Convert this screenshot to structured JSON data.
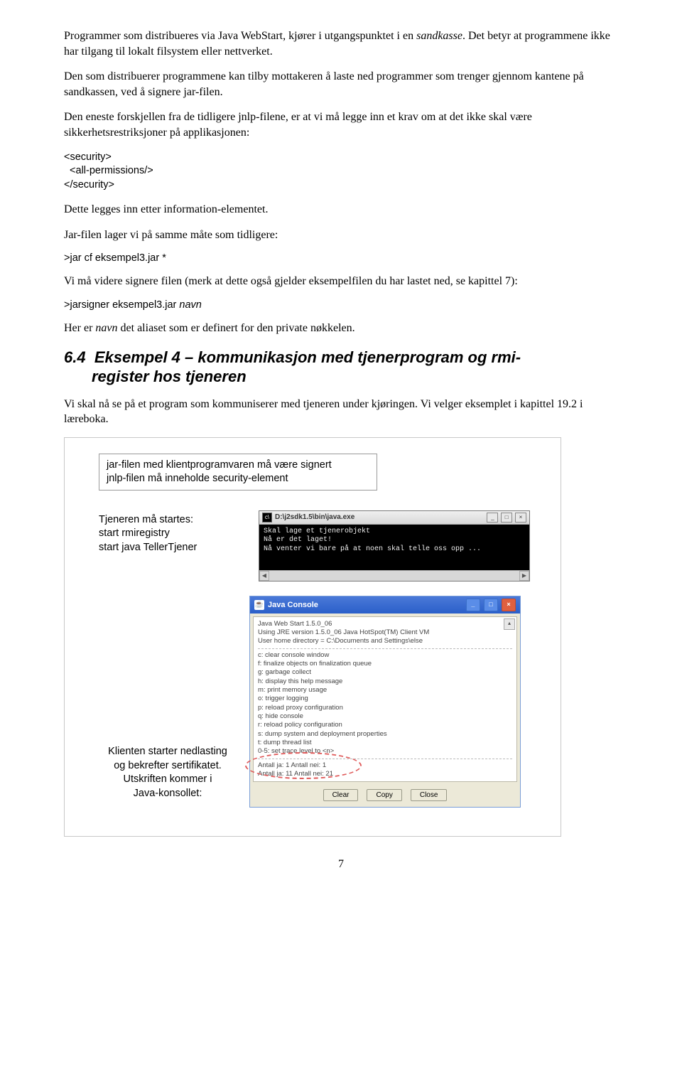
{
  "para1a": "Programmer som distribueres via Java WebStart, kjører i utgangspunktet i en ",
  "para1_i": "sandkasse",
  "para1b": ". Det betyr at programmene ikke har tilgang til lokalt filsystem eller nettverket.",
  "para2": "Den som distribuerer programmene kan tilby mottakeren å laste ned programmer som trenger gjennom kantene på sandkassen, ved å signere jar-filen.",
  "para3": "Den eneste forskjellen fra de tidligere jnlp-filene, er at vi må legge inn et krav om at det ikke skal være sikkerhetsrestriksjoner på applikasjonen:",
  "code1": "<security>\n  <all-permissions/>\n</security>",
  "para4": "Dette legges inn etter information-elementet.",
  "para5": "Jar-filen lager vi på samme måte som tidligere:",
  "cmd1": ">jar cf eksempel3.jar *",
  "para6": "Vi må videre signere filen (merk at dette også gjelder eksempelfilen du har lastet ned, se kapittel 7):",
  "cmd2a": ">jarsigner eksempel3.jar ",
  "cmd2_i": "navn",
  "para7a": "Her er ",
  "para7_i": "navn",
  "para7b": " det aliaset som er definert for den private nøkkelen.",
  "h2_num": "6.4",
  "h2_l1": "Eksempel 4 – kommunikasjon med tjenerprogram og rmi-",
  "h2_l2": "register hos tjeneren",
  "para8": "Vi skal nå se på et program som kommuniserer med tjeneren under kjøringen. Vi velger eksemplet i kapittel 19.2 i læreboka.",
  "box_top_l1": "jar-filen med klientprogramvaren må være signert",
  "box_top_l2": "jnlp-filen må inneholde security-element",
  "left1_l1": "Tjeneren må startes:",
  "left1_l2": "start rmiregistry",
  "left1_l3": "start java TellerTjener",
  "cmd_title": "D:\\j2sdk1.5\\bin\\java.exe",
  "cmd_body": "Skal lage et tjenerobjekt\nNå er det laget!\nNå venter vi bare på at noen skal telle oss opp ...",
  "left2_l1": "Klienten starter nedlasting",
  "left2_l2": "og bekrefter sertifikatet.",
  "left2_l3": "Utskriften kommer i",
  "left2_l4": "Java-konsollet:",
  "jc_title": "Java Console",
  "jc_h1": "Java Web Start 1.5.0_06",
  "jc_h2": "Using JRE version 1.5.0_06 Java HotSpot(TM) Client VM",
  "jc_h3": "User home directory = C:\\Documents and Settings\\else",
  "jc_c": "c:   clear console window",
  "jc_f": "f:   finalize objects on finalization queue",
  "jc_g": "g:   garbage collect",
  "jc_h": "h:   display this help message",
  "jc_m": "m:   print memory usage",
  "jc_o": "o:   trigger logging",
  "jc_p": "p:   reload proxy configuration",
  "jc_q": "q:   hide console",
  "jc_r": "r:   reload policy configuration",
  "jc_s": "s:   dump system and deployment properties",
  "jc_t": "t:   dump thread list",
  "jc_05": "0-5: set trace level to <n>",
  "jc_out1": "Antall ja: 1 Antall nei: 1",
  "jc_out2": "Antall ja: 11 Antall nei: 21",
  "btn_clear": "Clear",
  "btn_copy": "Copy",
  "btn_close": "Close",
  "page_num": "7"
}
